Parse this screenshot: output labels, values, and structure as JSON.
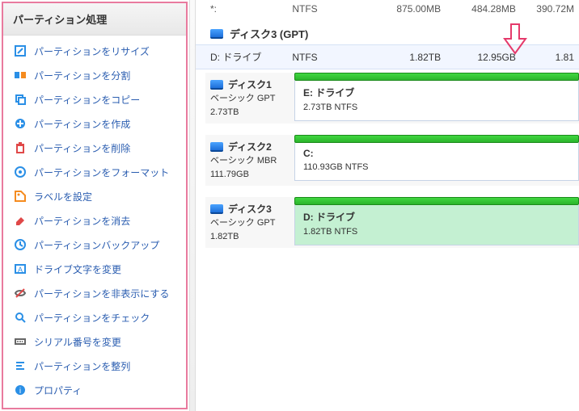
{
  "sidebar": {
    "title": "パーティション処理",
    "items": [
      {
        "label": "パーティションをリサイズ",
        "icon": "resize"
      },
      {
        "label": "パーティションを分割",
        "icon": "split"
      },
      {
        "label": "パーティションをコピー",
        "icon": "copy"
      },
      {
        "label": "パーティションを作成",
        "icon": "create"
      },
      {
        "label": "パーティションを削除",
        "icon": "delete"
      },
      {
        "label": "パーティションをフォーマット",
        "icon": "format"
      },
      {
        "label": "ラベルを設定",
        "icon": "label"
      },
      {
        "label": "パーティションを消去",
        "icon": "erase"
      },
      {
        "label": "パーティションバックアップ",
        "icon": "backup"
      },
      {
        "label": "ドライブ文字を変更",
        "icon": "letter"
      },
      {
        "label": "パーティションを非表示にする",
        "icon": "hide"
      },
      {
        "label": "パーティションをチェック",
        "icon": "check"
      },
      {
        "label": "シリアル番号を変更",
        "icon": "serial"
      },
      {
        "label": "パーティションを整列",
        "icon": "align"
      },
      {
        "label": "プロパティ",
        "icon": "props"
      }
    ]
  },
  "top": {
    "row0": {
      "label": "*:",
      "fs": "NTFS",
      "size": "875.00MB",
      "used": "484.28MB",
      "free": "390.72M"
    },
    "disk3title": "ディスク3 (GPT)",
    "row1": {
      "label": "D: ドライブ",
      "fs": "NTFS",
      "size": "1.82TB",
      "used": "12.95GB",
      "free": "1.81"
    }
  },
  "blocks": {
    "d1": {
      "name": "ディスク1",
      "type": "ベーシック GPT",
      "size": "2.73TB",
      "drive": "E: ドライブ",
      "info": "2.73TB NTFS"
    },
    "d2": {
      "name": "ディスク2",
      "type": "ベーシック MBR",
      "size": "111.79GB",
      "drive": "C:",
      "info": "110.93GB NTFS"
    },
    "d3": {
      "name": "ディスク3",
      "type": "ベーシック GPT",
      "size": "1.82TB",
      "drive": "D: ドライブ",
      "info": "1.82TB NTFS"
    }
  },
  "arrow_color": "#e53a6b"
}
